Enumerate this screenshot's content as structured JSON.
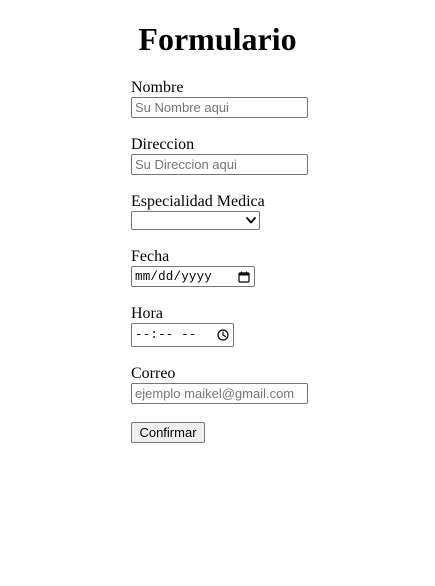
{
  "page": {
    "title": "Formulario"
  },
  "form": {
    "nombre": {
      "label": "Nombre",
      "value": "",
      "placeholder": "Su Nombre aqui"
    },
    "direccion": {
      "label": "Direccion",
      "value": "",
      "placeholder": "Su Direccion aqui"
    },
    "especialidad": {
      "label": "Especialidad Medica",
      "selected": ""
    },
    "fecha": {
      "label": "Fecha",
      "placeholder": "mm/dd/yyyy",
      "icon": "calendar-icon"
    },
    "hora": {
      "label": "Hora",
      "placeholder": "--:-- --",
      "icon": "clock-icon"
    },
    "correo": {
      "label": "Correo",
      "value": "",
      "placeholder": "ejemplo maikel@gmail.com"
    },
    "submit_label": "Confirmar"
  }
}
